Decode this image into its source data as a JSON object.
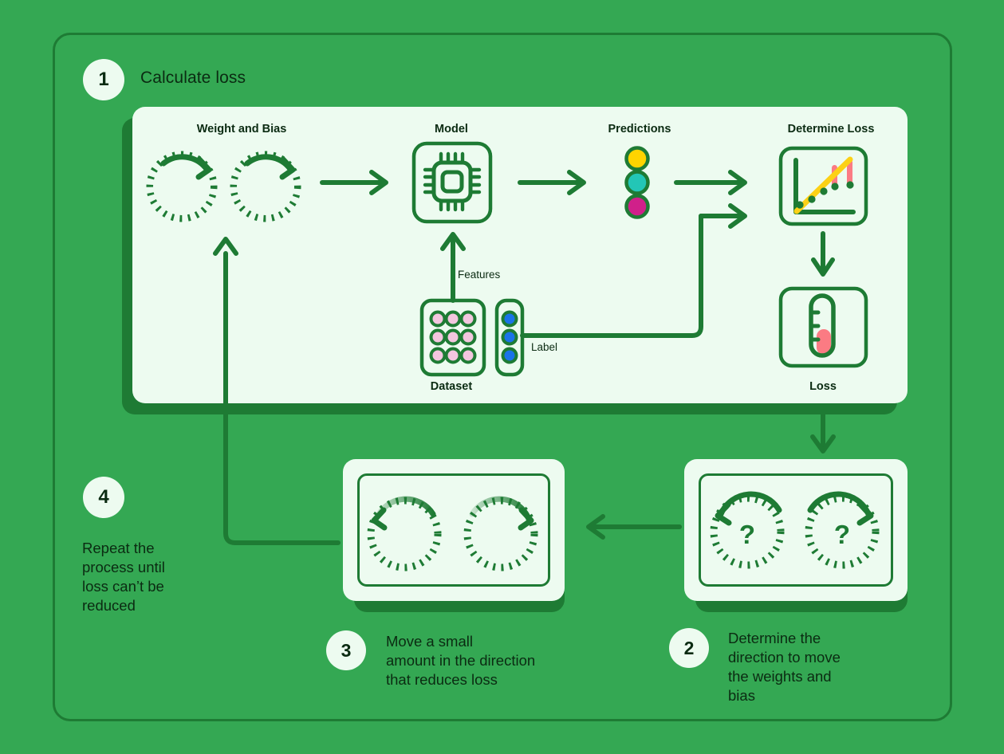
{
  "colors": {
    "background_green": "#34A853",
    "dark_green": "#1E7B34",
    "panel_mint": "#EDFBF0",
    "text_dark": "#0b2b12",
    "prediction_yellow": "#FFD400",
    "prediction_cyan": "#23C6B6",
    "prediction_magenta": "#D0208A",
    "feature_pink": "#F3C6DF",
    "label_blue": "#1A73E8",
    "loss_red": "#FB7B83",
    "trend_yellow": "#FCD116"
  },
  "steps": [
    {
      "number": "1",
      "title": "Calculate loss"
    },
    {
      "number": "2",
      "text": "Determine the\ndirection to move\nthe weights and\nbias"
    },
    {
      "number": "3",
      "text": "Move a small\namount in the direction\nthat reduces loss"
    },
    {
      "number": "4",
      "text": "Repeat the\nprocess until\nloss can’t be\nreduced"
    }
  ],
  "panel1": {
    "columns": [
      {
        "title": "Weight and Bias"
      },
      {
        "title": "Model"
      },
      {
        "title": "Predictions"
      },
      {
        "title": "Determine Loss"
      }
    ],
    "dataset_label": "Dataset",
    "features_label": "Features",
    "label_label": "Label",
    "loss_label": "Loss",
    "prediction_dots": [
      "yellow",
      "cyan",
      "magenta"
    ],
    "dataset_feature_dots": 9,
    "dataset_label_dots": 3,
    "model_icon": "chip-icon",
    "determine_loss_icon": "scatter-trendline-icon",
    "loss_icon": "thermometer-icon"
  },
  "card3": {
    "dials": [
      "dial-counterclockwise",
      "dial-clockwise"
    ]
  },
  "card2": {
    "dials": [
      "dial-question-left",
      "dial-question-right"
    ],
    "dial_glyph": "?"
  }
}
